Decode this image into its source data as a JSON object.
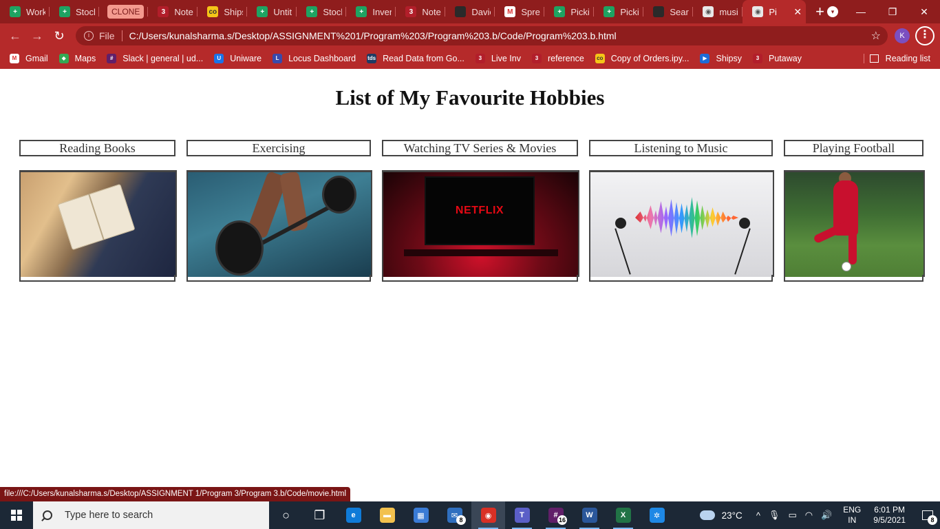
{
  "browser": {
    "tabs": [
      {
        "label": "Work",
        "icon": "sheets-icon",
        "favclass": "fav-sheets",
        "glyph": "+"
      },
      {
        "label": "Stock",
        "icon": "sheets-icon",
        "favclass": "fav-sheets",
        "glyph": "+"
      },
      {
        "label": "CLONE",
        "icon": "clone-label",
        "favclass": "",
        "glyph": ""
      },
      {
        "label": "Notel",
        "icon": "notion-icon",
        "favclass": "fav-red",
        "glyph": "3"
      },
      {
        "label": "Ships",
        "icon": "colab-icon",
        "favclass": "fav-yellow",
        "glyph": "co"
      },
      {
        "label": "Untitl",
        "icon": "sheets-icon",
        "favclass": "fav-sheets",
        "glyph": "+"
      },
      {
        "label": "Stock",
        "icon": "sheets-icon",
        "favclass": "fav-sheets",
        "glyph": "+"
      },
      {
        "label": "Inven",
        "icon": "sheets-icon",
        "favclass": "fav-sheets",
        "glyph": "+"
      },
      {
        "label": "Notel",
        "icon": "notion-icon",
        "favclass": "fav-red",
        "glyph": "3"
      },
      {
        "label": "Davic",
        "icon": "github-icon",
        "favclass": "fav-gh",
        "glyph": ""
      },
      {
        "label": "Sprea",
        "icon": "gmail-icon",
        "favclass": "fav-gmail",
        "glyph": "M"
      },
      {
        "label": "Pickil",
        "icon": "sheets-icon",
        "favclass": "fav-sheets",
        "glyph": "+"
      },
      {
        "label": "Pickil",
        "icon": "sheets-icon",
        "favclass": "fav-sheets",
        "glyph": "+"
      },
      {
        "label": "Searc",
        "icon": "github-icon",
        "favclass": "fav-gh",
        "glyph": ""
      },
      {
        "label": "musi",
        "icon": "globe-icon",
        "favclass": "fav-globe",
        "glyph": "◉"
      },
      {
        "label": "Pi",
        "icon": "globe-icon",
        "favclass": "fav-globe",
        "glyph": "◉",
        "active": true
      }
    ],
    "new_tab": "+",
    "address": {
      "security_label": "File",
      "url": "C:/Users/kunalsharma.s/Desktop/ASSIGNMENT%201/Program%203/Program%203.b/Code/Program%203.b.html"
    },
    "profile_initial": "K",
    "bookmarks": [
      {
        "label": "Gmail",
        "icon": "gmail-icon",
        "color": "#ffffff",
        "glyph": "M",
        "text_color": "#d33"
      },
      {
        "label": "Maps",
        "icon": "maps-icon",
        "color": "#34a853",
        "glyph": "◆",
        "text_color": "#fff"
      },
      {
        "label": "Slack | general | ud...",
        "icon": "slack-icon",
        "color": "#611f69",
        "glyph": "#",
        "text_color": "#fff"
      },
      {
        "label": "Uniware",
        "icon": "uniware-icon",
        "color": "#1a73e8",
        "glyph": "U",
        "text_color": "#fff"
      },
      {
        "label": "Locus Dashboard",
        "icon": "locus-icon",
        "color": "#3949ab",
        "glyph": "L",
        "text_color": "#fff"
      },
      {
        "label": "Read Data from Go...",
        "icon": "tds-icon",
        "color": "#1f3b63",
        "glyph": "tds",
        "text_color": "#fff"
      },
      {
        "label": "Live Inv",
        "icon": "notion-icon",
        "color": "#b21e2a",
        "glyph": "3",
        "text_color": "#fff"
      },
      {
        "label": "reference",
        "icon": "notion-icon",
        "color": "#b21e2a",
        "glyph": "3",
        "text_color": "#fff"
      },
      {
        "label": "Copy of Orders.ipy...",
        "icon": "colab-icon",
        "color": "#f5c518",
        "glyph": "co",
        "text_color": "#333"
      },
      {
        "label": "Shipsy",
        "icon": "shipsy-icon",
        "color": "#1e6bd6",
        "glyph": "▶",
        "text_color": "#fff"
      },
      {
        "label": "Putaway",
        "icon": "notion-icon",
        "color": "#b21e2a",
        "glyph": "3",
        "text_color": "#fff"
      }
    ],
    "reading_list": "Reading list",
    "status_url": "file:///C:/Users/kunalsharma.s/Desktop/ASSIGNMENT 1/Program 3/Program 3.b/Code/movie.html"
  },
  "page": {
    "title": "List of My Favourite Hobbies",
    "hobbies": [
      {
        "label": "Reading Books",
        "image": "reading-photo"
      },
      {
        "label": "Exercising",
        "image": "barbell-photo"
      },
      {
        "label": "Watching TV Series & Movies",
        "image": "netflix-tv-photo",
        "screen_text": "NETFLIX"
      },
      {
        "label": "Listening to Music",
        "image": "earphones-soundwave-photo"
      },
      {
        "label": "Playing Football",
        "image": "footballer-photo"
      }
    ]
  },
  "taskbar": {
    "search_placeholder": "Type here to search",
    "apps": [
      {
        "name": "cortana-icon",
        "color": "transparent",
        "glyph": "○",
        "running": false
      },
      {
        "name": "task-view-icon",
        "color": "transparent",
        "glyph": "❐",
        "running": false
      },
      {
        "name": "edge-icon",
        "color": "#0f7bd8",
        "glyph": "e",
        "running": false
      },
      {
        "name": "file-explorer-icon",
        "color": "#f2c14e",
        "glyph": "▬",
        "running": false
      },
      {
        "name": "store-icon",
        "color": "#3a7bd5",
        "glyph": "▦",
        "running": false
      },
      {
        "name": "mail-icon",
        "color": "#2f6fbf",
        "glyph": "✉",
        "running": false,
        "badge": "8"
      },
      {
        "name": "chrome-icon",
        "color": "#d93025",
        "glyph": "◉",
        "running": true,
        "active": true
      },
      {
        "name": "teams-icon",
        "color": "#5b5fc7",
        "glyph": "T",
        "running": true
      },
      {
        "name": "slack-icon",
        "color": "#611f69",
        "glyph": "#",
        "running": true,
        "badge": "16"
      },
      {
        "name": "word-icon",
        "color": "#2b579a",
        "glyph": "W",
        "running": true
      },
      {
        "name": "excel-icon",
        "color": "#217346",
        "glyph": "X",
        "running": true
      },
      {
        "name": "network-app-icon",
        "color": "#1e88e5",
        "glyph": "✲",
        "running": false
      }
    ],
    "weather": "23°C",
    "language": {
      "line1": "ENG",
      "line2": "IN"
    },
    "clock": {
      "time": "6:01 PM",
      "date": "9/5/2021"
    },
    "notifications_badge": "8"
  }
}
